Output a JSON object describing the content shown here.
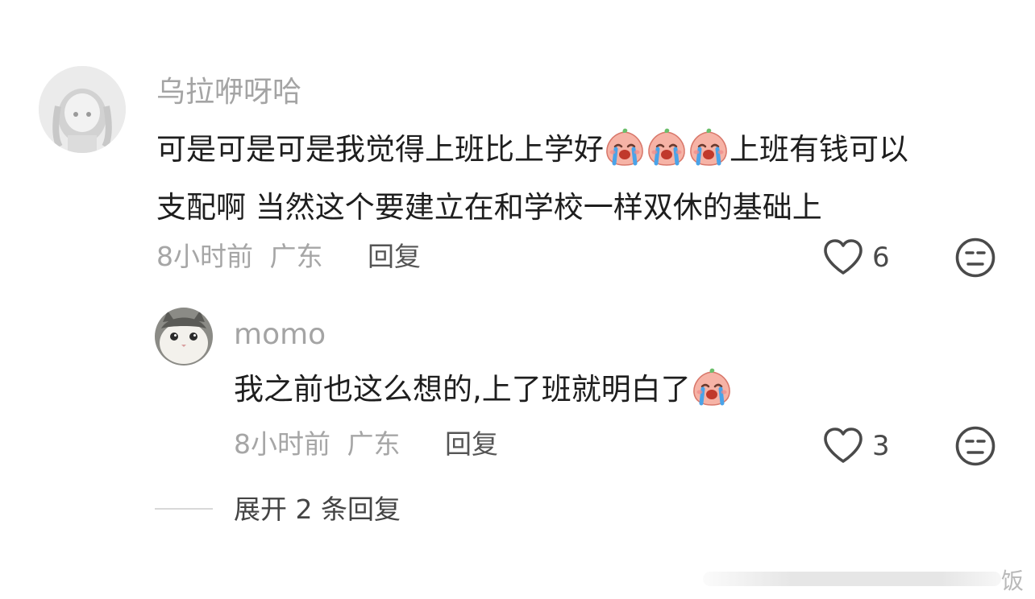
{
  "comment": {
    "username": "乌拉咿呀哈",
    "text_line1": "可是可是可是我觉得上班比上学好",
    "text_line1_after": "上班有钱可以",
    "text_line2": "支配啊 当然这个要建立在和学校一样双休的基础上",
    "time": "8小时前",
    "location": "广东",
    "reply_label": "回复",
    "likes": "6"
  },
  "reply": {
    "username": "momo",
    "text": "我之前也这么想的,上了班就明白了",
    "time": "8小时前",
    "location": "广东",
    "reply_label": "回复",
    "likes": "3"
  },
  "expand_label": "展开 2 条回复",
  "watermark_tail": "饭",
  "icons": {
    "like": "heart-outline-icon",
    "dislike": "meh-face-icon",
    "emoji": "crying-peach-emoji"
  }
}
